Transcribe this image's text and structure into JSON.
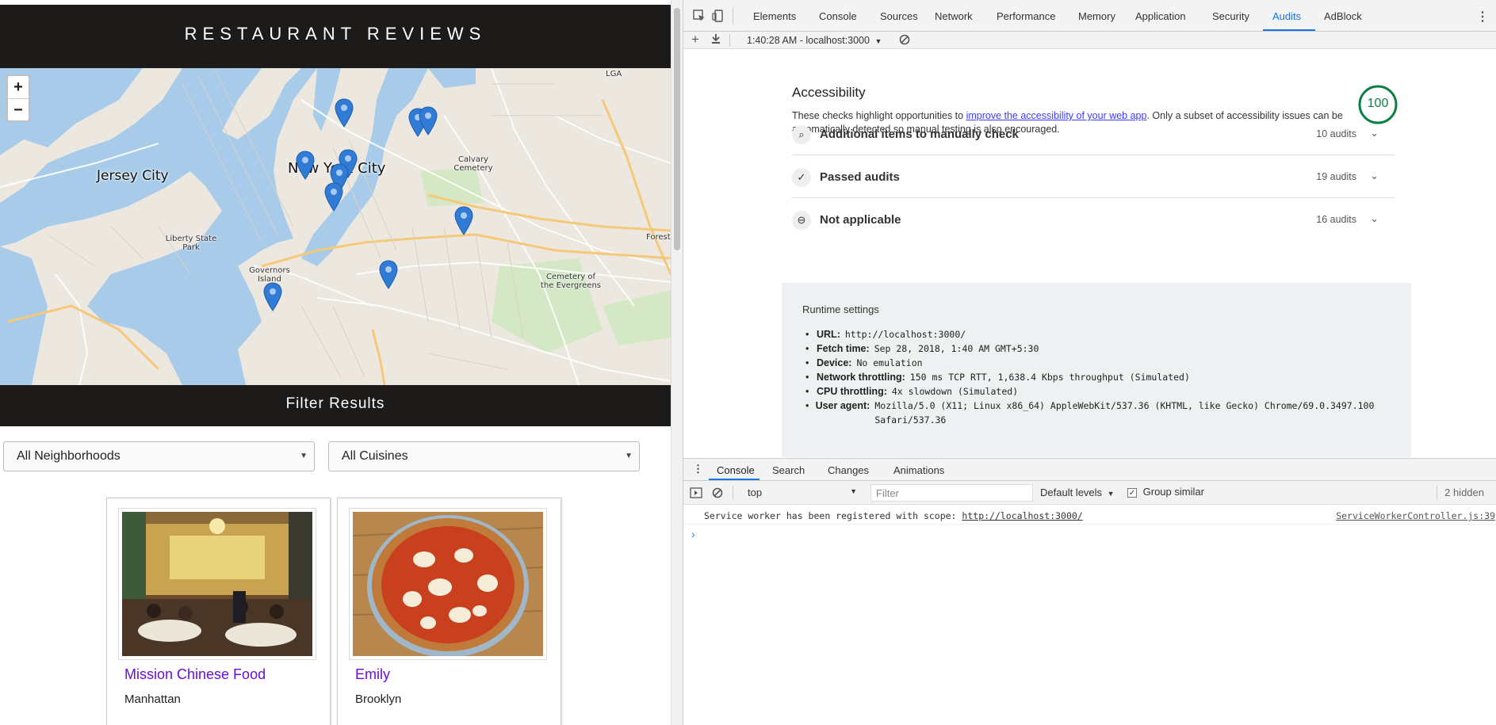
{
  "app": {
    "title": "RESTAURANT REVIEWS",
    "filter_title": "Filter Results",
    "neighborhood_select": "All Neighborhoods",
    "cuisine_select": "All Cuisines",
    "map": {
      "zoom_in": "+",
      "zoom_out": "−",
      "labels": {
        "jersey_city": "Jersey City",
        "new_york_city": "New York City",
        "liberty_state_park": "Liberty State Park",
        "governors_island": "Governors Island",
        "calvary_cemetery": "Calvary Cemetery",
        "cemetery_evergreens": "Cemetery of the Evergreens",
        "lga": "LGA",
        "forest": "Forest"
      }
    },
    "restaurants": [
      {
        "name": "Mission Chinese Food",
        "neighborhood": "Manhattan"
      },
      {
        "name": "Emily",
        "neighborhood": "Brooklyn"
      }
    ]
  },
  "devtools": {
    "tabs": [
      "Elements",
      "Console",
      "Sources",
      "Network",
      "Performance",
      "Memory",
      "Application",
      "Security",
      "Audits",
      "AdBlock"
    ],
    "active_tab": "Audits",
    "report_selector": "1:40:28 AM - localhost:3000",
    "audits": {
      "category_title": "Accessibility",
      "score": "100",
      "description_before": "These checks highlight opportunities to ",
      "description_link": "improve the accessibility of your web app",
      "description_after": ". Only a subset of accessibility issues can be automatically detected so manual testing is also encouraged.",
      "groups": [
        {
          "label": "Additional items to manually check",
          "count": "10 audits",
          "icon": "search-icon"
        },
        {
          "label": "Passed audits",
          "count": "19 audits",
          "icon": "check-icon"
        },
        {
          "label": "Not applicable",
          "count": "16 audits",
          "icon": "minus-circle-icon"
        }
      ],
      "runtime": {
        "title": "Runtime settings",
        "items": [
          {
            "key": "URL:",
            "value": "http://localhost:3000/"
          },
          {
            "key": "Fetch time:",
            "value": "Sep 28, 2018, 1:40 AM GMT+5:30"
          },
          {
            "key": "Device:",
            "value": "No emulation"
          },
          {
            "key": "Network throttling:",
            "value": "150 ms TCP RTT, 1,638.4 Kbps throughput (Simulated)"
          },
          {
            "key": "CPU throttling:",
            "value": "4x slowdown (Simulated)"
          },
          {
            "key": "User agent:",
            "value": "Mozilla/5.0 (X11; Linux x86_64) AppleWebKit/537.36 (KHTML, like Gecko) Chrome/69.0.3497.100 Safari/537.36"
          }
        ]
      }
    },
    "drawer": {
      "tabs": [
        "Console",
        "Search",
        "Changes",
        "Animations"
      ],
      "active_tab": "Console",
      "context": "top",
      "filter_placeholder": "Filter",
      "levels": "Default levels",
      "group_similar": "Group similar",
      "hidden_count": "2 hidden",
      "message_text": "Service worker has been registered with scope: ",
      "message_link": "http://localhost:3000/",
      "message_source": "ServiceWorkerController.js:39",
      "prompt": "›"
    }
  }
}
